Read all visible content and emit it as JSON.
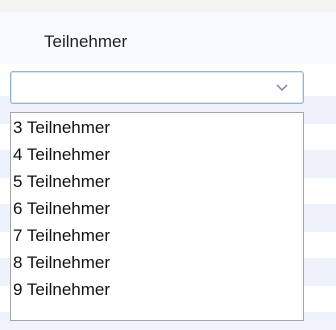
{
  "table": {
    "column_header": "Teilnehmer"
  },
  "select": {
    "value": "",
    "chevron_icon": "chevron-down-icon",
    "colors": {
      "border": "#9ab4d4",
      "chevron": "#7a8699"
    }
  },
  "dropdown": {
    "options": [
      "3 Teilnehmer",
      "4 Teilnehmer",
      "5 Teilnehmer",
      "6 Teilnehmer",
      "7 Teilnehmer",
      "8 Teilnehmer",
      "9 Teilnehmer"
    ]
  }
}
